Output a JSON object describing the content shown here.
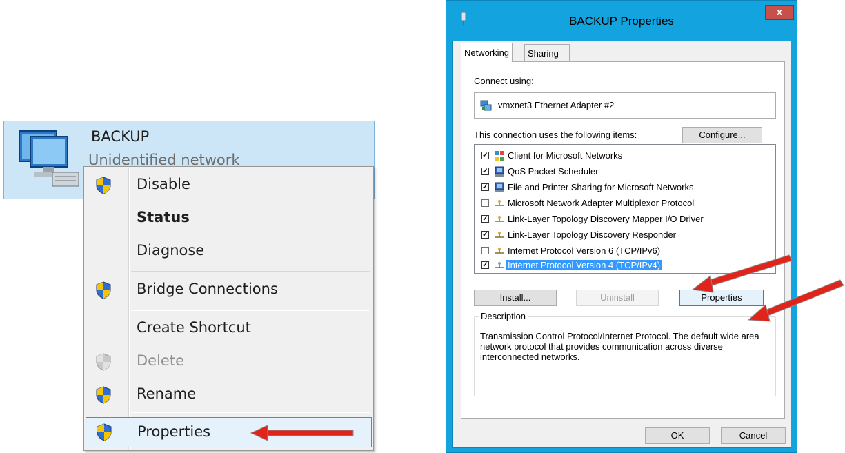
{
  "network": {
    "name": "BACKUP",
    "status": "Unidentified network"
  },
  "context_menu": {
    "items": [
      {
        "label": "Disable",
        "shield": true
      },
      {
        "label": "Status",
        "shield": false,
        "bold": true
      },
      {
        "label": "Diagnose",
        "shield": false
      },
      {
        "label": "Bridge Connections",
        "shield": true
      },
      {
        "label": "Create Shortcut",
        "shield": false
      },
      {
        "label": "Delete",
        "shield": true,
        "disabled": true
      },
      {
        "label": "Rename",
        "shield": true
      },
      {
        "label": "Properties",
        "shield": true,
        "highlighted": true
      }
    ]
  },
  "dialog": {
    "title": "BACKUP Properties",
    "close_label": "x",
    "tabs": [
      "Networking",
      "Sharing"
    ],
    "connect_using_label": "Connect using:",
    "adapter_name": "vmxnet3 Ethernet Adapter #2",
    "configure_label": "Configure...",
    "items_label": "This connection uses the following items:",
    "items": [
      {
        "label": "Client for Microsoft Networks",
        "checked": true,
        "icon": "network-client-icon"
      },
      {
        "label": "QoS Packet Scheduler",
        "checked": true,
        "icon": "service-icon"
      },
      {
        "label": "File and Printer Sharing for Microsoft Networks",
        "checked": true,
        "icon": "service-icon"
      },
      {
        "label": "Microsoft Network Adapter Multiplexor Protocol",
        "checked": false,
        "icon": "protocol-icon"
      },
      {
        "label": "Link-Layer Topology Discovery Mapper I/O Driver",
        "checked": true,
        "icon": "protocol-icon"
      },
      {
        "label": "Link-Layer Topology Discovery Responder",
        "checked": true,
        "icon": "protocol-icon"
      },
      {
        "label": "Internet Protocol Version 6 (TCP/IPv6)",
        "checked": false,
        "icon": "protocol-icon"
      },
      {
        "label": "Internet Protocol Version 4 (TCP/IPv4)",
        "checked": true,
        "icon": "protocol-icon",
        "selected": true
      }
    ],
    "install_label": "Install...",
    "uninstall_label": "Uninstall",
    "properties_label": "Properties",
    "description_legend": "Description",
    "description_text": "Transmission Control Protocol/Internet Protocol. The default wide area network protocol that provides communication across diverse interconnected networks.",
    "ok_label": "OK",
    "cancel_label": "Cancel"
  },
  "colors": {
    "arrow": "#e2231a",
    "selection": "#3399ff",
    "title_bar": "#13a4e0",
    "close_button": "#c7504b"
  }
}
